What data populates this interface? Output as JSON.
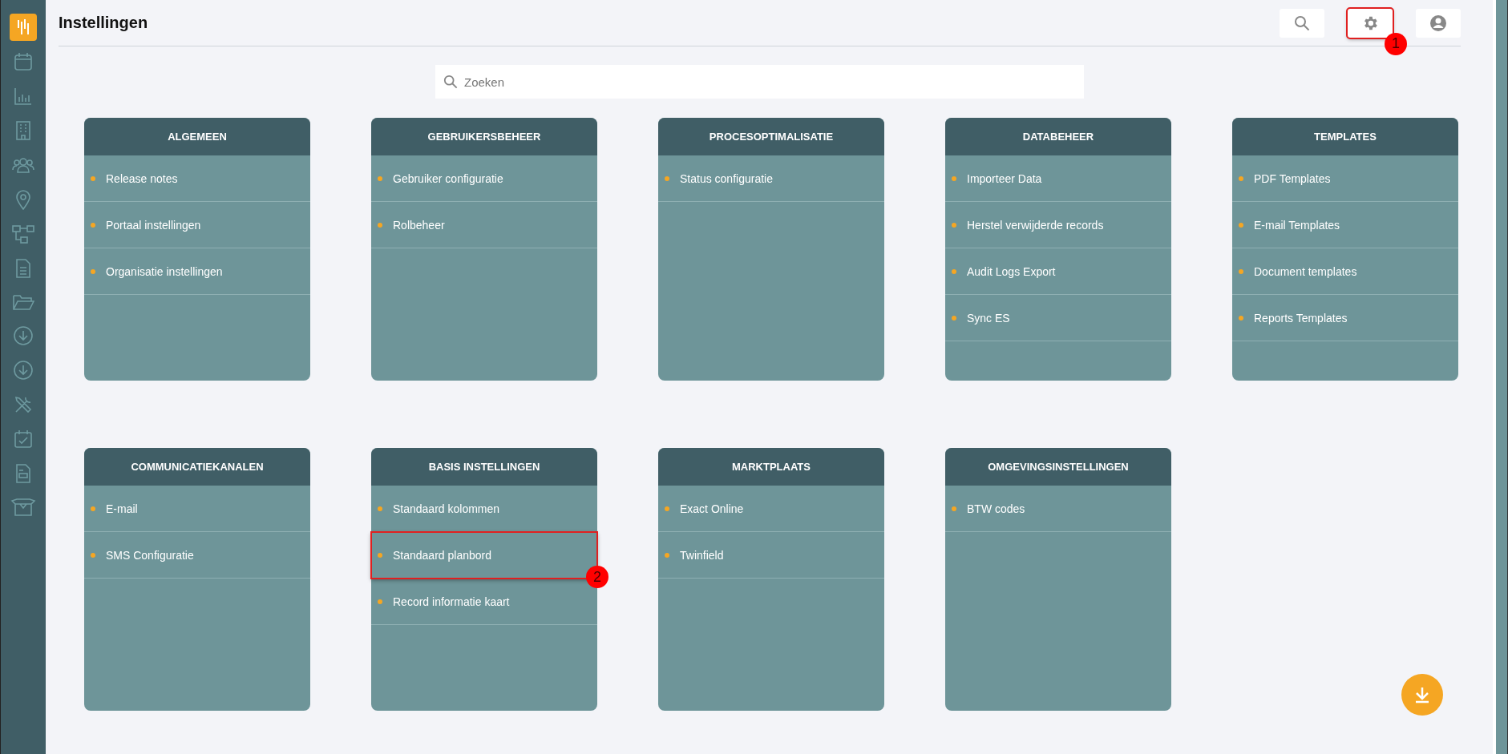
{
  "page": {
    "title": "Instellingen"
  },
  "toolbar": [
    {
      "kind": "search",
      "highlighted": false
    },
    {
      "kind": "settings",
      "highlighted": true,
      "marker": "1"
    },
    {
      "kind": "account",
      "highlighted": false
    }
  ],
  "search": {
    "placeholder": "Zoeken"
  },
  "cards": [
    {
      "title": "ALGEMEEN",
      "items": [
        {
          "label": "Release notes",
          "highlighted": false
        },
        {
          "label": "Portaal instellingen",
          "highlighted": false
        },
        {
          "label": "Organisatie instellingen",
          "highlighted": false
        }
      ]
    },
    {
      "title": "GEBRUIKERSBEHEER",
      "items": [
        {
          "label": "Gebruiker configuratie",
          "highlighted": false
        },
        {
          "label": "Rolbeheer",
          "highlighted": false
        }
      ]
    },
    {
      "title": "PROCESOPTIMALISATIE",
      "items": [
        {
          "label": "Status configuratie",
          "highlighted": false
        }
      ]
    },
    {
      "title": "DATABEHEER",
      "items": [
        {
          "label": "Importeer Data",
          "highlighted": false
        },
        {
          "label": "Herstel verwijderde records",
          "highlighted": false
        },
        {
          "label": "Audit Logs Export",
          "highlighted": false
        },
        {
          "label": "Sync ES",
          "highlighted": false
        }
      ]
    },
    {
      "title": "TEMPLATES",
      "items": [
        {
          "label": "PDF Templates",
          "highlighted": false
        },
        {
          "label": "E-mail Templates",
          "highlighted": false
        },
        {
          "label": "Document templates",
          "highlighted": false
        },
        {
          "label": "Reports Templates",
          "highlighted": false
        }
      ]
    },
    {
      "title": "COMMUNICATIEKANALEN",
      "items": [
        {
          "label": "E-mail",
          "highlighted": false
        },
        {
          "label": "SMS Configuratie",
          "highlighted": false
        }
      ]
    },
    {
      "title": "BASIS INSTELLINGEN",
      "items": [
        {
          "label": "Standaard kolommen",
          "highlighted": false
        },
        {
          "label": "Standaard planbord",
          "highlighted": true,
          "marker": "2"
        },
        {
          "label": "Record informatie kaart",
          "highlighted": false
        }
      ]
    },
    {
      "title": "MARKTPLAATS",
      "items": [
        {
          "label": "Exact Online",
          "highlighted": false
        },
        {
          "label": "Twinfield",
          "highlighted": false
        }
      ]
    },
    {
      "title": "OMGEVINGSINSTELLINGEN",
      "items": [
        {
          "label": "BTW codes",
          "highlighted": false
        }
      ]
    }
  ]
}
